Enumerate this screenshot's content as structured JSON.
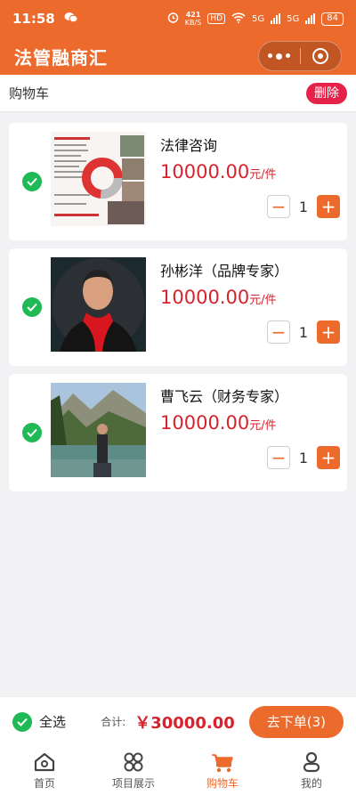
{
  "status_bar": {
    "time": "11:58",
    "net_speed_value": "421",
    "net_speed_unit": "KB/S",
    "hd_label": "HD",
    "network_1": "5G",
    "network_2": "5G",
    "battery": "84"
  },
  "app": {
    "title": "法管融商汇"
  },
  "cart": {
    "title": "购物车",
    "delete_label": "删除",
    "items": [
      {
        "name": "法律咨询",
        "price": "10000.00",
        "unit": "元/件",
        "qty": "1",
        "checked": true,
        "image": "legal-consult-poster"
      },
      {
        "name": "孙彬洋（品牌专家）",
        "price": "10000.00",
        "unit": "元/件",
        "qty": "1",
        "checked": true,
        "image": "portrait-man-red-scarf"
      },
      {
        "name": "曹飞云（财务专家）",
        "price": "10000.00",
        "unit": "元/件",
        "qty": "1",
        "checked": true,
        "image": "portrait-man-lake"
      }
    ]
  },
  "checkout": {
    "select_all_label": "全选",
    "total_label": "合计:",
    "total_amount": "￥30000.00",
    "order_button": "去下单(3)"
  },
  "tabbar": {
    "items": [
      {
        "label": "首页",
        "icon": "home-icon",
        "active": false
      },
      {
        "label": "项目展示",
        "icon": "grid-icon",
        "active": false
      },
      {
        "label": "购物车",
        "icon": "cart-icon",
        "active": true
      },
      {
        "label": "我的",
        "icon": "user-icon",
        "active": false
      }
    ]
  },
  "colors": {
    "primary": "#ec6a2c",
    "price": "#d8232f",
    "check": "#1fb955",
    "delete": "#e6224a"
  }
}
